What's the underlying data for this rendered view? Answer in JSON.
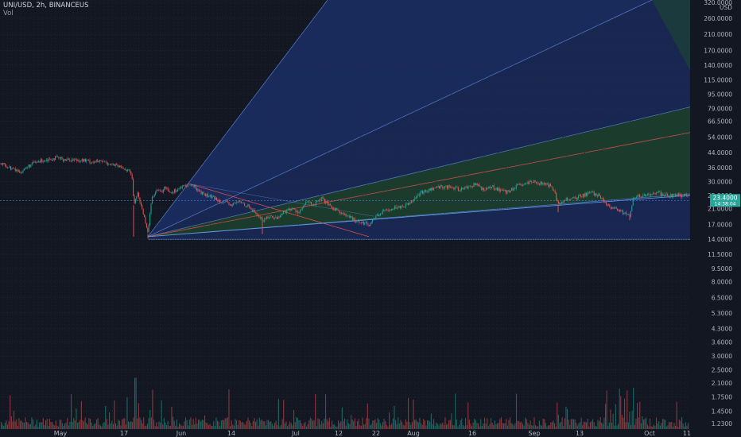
{
  "header": {
    "symbol_line": "UNI/USD, 2h, BINANCEUS",
    "volume_label": "Vol"
  },
  "price_axis": {
    "unit": "USD",
    "current_price_label": "23.4000",
    "current_price_label_2": "14:38:04"
  },
  "colors": {
    "background": "#131722",
    "grid": "#2a2e39",
    "fan_blue": "#1f3c8c",
    "fan_green": "#1f4a30",
    "up_candle": "#26a69a",
    "down_candle": "#ef5350",
    "median_line": "#e05050",
    "price_line": "#4a7fd0",
    "current_price_bg": "#26a69a"
  },
  "chart_data": {
    "type": "candlestick",
    "scale": "log",
    "y_ticks": [
      "320.0000",
      "260.0000",
      "210.0000",
      "170.0000",
      "140.0000",
      "115.0000",
      "95.0000",
      "79.0000",
      "66.5000",
      "54.0000",
      "44.0000",
      "36.0000",
      "30.0000",
      "25.0000",
      "21.0000",
      "17.0000",
      "14.0000",
      "11.5000",
      "9.5000",
      "8.0000",
      "6.5000",
      "5.3000",
      "4.3000",
      "3.6000",
      "3.0000",
      "2.5000",
      "2.1000",
      "1.7500",
      "1.4500",
      "1.2300"
    ],
    "y_tick_values": [
      320,
      260,
      210,
      170,
      140,
      115,
      95,
      79,
      66.5,
      54,
      44,
      36,
      30,
      25,
      21,
      17,
      14,
      11.5,
      9.5,
      8,
      6.5,
      5.3,
      4.3,
      3.6,
      3,
      2.5,
      2.1,
      1.75,
      1.45,
      1.23
    ],
    "x_ticks": [
      "May",
      "17",
      "Jun",
      "14",
      "Jul",
      "12",
      "22",
      "Aug",
      "16",
      "Sep",
      "13",
      "Oct",
      "11"
    ],
    "price_path": [
      [
        0,
        38
      ],
      [
        12,
        36
      ],
      [
        25,
        34
      ],
      [
        40,
        38
      ],
      [
        55,
        40
      ],
      [
        70,
        41
      ],
      [
        85,
        40
      ],
      [
        100,
        40
      ],
      [
        115,
        39
      ],
      [
        130,
        39
      ],
      [
        145,
        37
      ],
      [
        160,
        35
      ],
      [
        165,
        33
      ],
      [
        168,
        22
      ],
      [
        172,
        26
      ],
      [
        178,
        21
      ],
      [
        182,
        18
      ],
      [
        186,
        15
      ],
      [
        190,
        24
      ],
      [
        196,
        27
      ],
      [
        202,
        26
      ],
      [
        208,
        28
      ],
      [
        214,
        26
      ],
      [
        222,
        27
      ],
      [
        230,
        28
      ],
      [
        236,
        29
      ],
      [
        244,
        28
      ],
      [
        252,
        26
      ],
      [
        260,
        25
      ],
      [
        270,
        24
      ],
      [
        280,
        23
      ],
      [
        290,
        22
      ],
      [
        300,
        23
      ],
      [
        310,
        22
      ],
      [
        320,
        20
      ],
      [
        330,
        18
      ],
      [
        338,
        19
      ],
      [
        348,
        18.5
      ],
      [
        356,
        20
      ],
      [
        366,
        21
      ],
      [
        376,
        20
      ],
      [
        386,
        23
      ],
      [
        394,
        22
      ],
      [
        404,
        24
      ],
      [
        412,
        22
      ],
      [
        420,
        21
      ],
      [
        428,
        20
      ],
      [
        436,
        19
      ],
      [
        446,
        18
      ],
      [
        456,
        17.5
      ],
      [
        464,
        17
      ],
      [
        472,
        19
      ],
      [
        480,
        20
      ],
      [
        490,
        21
      ],
      [
        500,
        21.5
      ],
      [
        510,
        22
      ],
      [
        520,
        24
      ],
      [
        530,
        26
      ],
      [
        540,
        27
      ],
      [
        552,
        28
      ],
      [
        564,
        28
      ],
      [
        576,
        27
      ],
      [
        588,
        28
      ],
      [
        598,
        29
      ],
      [
        608,
        27
      ],
      [
        618,
        28
      ],
      [
        628,
        27
      ],
      [
        638,
        26
      ],
      [
        648,
        28
      ],
      [
        660,
        29
      ],
      [
        672,
        30
      ],
      [
        684,
        29
      ],
      [
        694,
        28
      ],
      [
        702,
        22
      ],
      [
        712,
        24
      ],
      [
        722,
        24
      ],
      [
        732,
        25
      ],
      [
        742,
        26
      ],
      [
        752,
        25
      ],
      [
        762,
        22
      ],
      [
        772,
        21
      ],
      [
        782,
        20
      ],
      [
        792,
        19
      ],
      [
        796,
        24
      ],
      [
        806,
        25
      ],
      [
        816,
        25
      ],
      [
        826,
        26
      ],
      [
        836,
        25
      ],
      [
        846,
        25
      ],
      [
        856,
        25
      ],
      [
        866,
        25
      ]
    ],
    "fan_origin_date_index": 186,
    "fan_origin_price": 14.5,
    "note_lines": "pitchfan"
  }
}
